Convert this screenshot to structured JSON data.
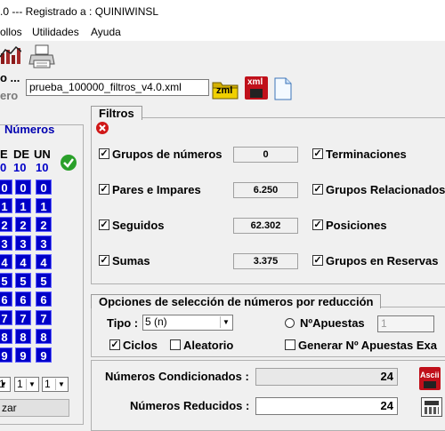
{
  "window": {
    "title": ".0 --- Registrado a : QUINIWINSL"
  },
  "menu": {
    "items": [
      "ollos",
      "Utilidades",
      "Ayuda"
    ]
  },
  "toolbar": {
    "label_top": "o ...",
    "label_bottom": "ero"
  },
  "file": {
    "name": "prueba_100000_filtros_v4.0.xml"
  },
  "icons": {
    "xml_folder": "zml",
    "xml_save": "xml"
  },
  "left_panel": {
    "title": "Números",
    "header": [
      "E",
      "DE",
      "UN"
    ],
    "header_values": [
      "0",
      "10",
      "10",
      "10"
    ],
    "rows": [
      [
        "0",
        "0",
        "0"
      ],
      [
        "1",
        "1",
        "1"
      ],
      [
        "2",
        "2",
        "2"
      ],
      [
        "3",
        "3",
        "3"
      ],
      [
        "4",
        "4",
        "4"
      ],
      [
        "5",
        "5",
        "5"
      ],
      [
        "6",
        "6",
        "6"
      ],
      [
        "7",
        "7",
        "7"
      ],
      [
        "8",
        "8",
        "8"
      ],
      [
        "9",
        "9",
        "9"
      ]
    ],
    "selects": [
      "1",
      "1",
      "1"
    ],
    "button": "zar"
  },
  "filtros": {
    "title": "Filtros",
    "items": [
      {
        "label": "Grupos de números",
        "value": "0",
        "checked": true
      },
      {
        "label": "Pares e Impares",
        "value": "6.250",
        "checked": true
      },
      {
        "label": "Seguidos",
        "value": "62.302",
        "checked": true
      },
      {
        "label": "Sumas",
        "value": "3.375",
        "checked": true
      }
    ],
    "right_items": [
      {
        "label": "Terminaciones",
        "checked": true
      },
      {
        "label": "Grupos Relacionados",
        "checked": true
      },
      {
        "label": "Posiciones",
        "checked": true
      },
      {
        "label": "Grupos en Reservas",
        "checked": true
      }
    ]
  },
  "opciones": {
    "title": "Opciones de selección de números por reducción",
    "tipo_label": "Tipo :",
    "tipo_value": "5 (n)",
    "napuestas_label": "NºApuestas",
    "napuestas_value": "1",
    "ciclos_label": "Ciclos",
    "ciclos_checked": true,
    "aleatorio_label": "Aleatorio",
    "aleatorio_checked": false,
    "generar_label": "Generar Nº Apuestas Exa",
    "generar_checked": false
  },
  "results": {
    "condicionados_label": "Números Condicionados :",
    "condicionados_value": "24",
    "reducidos_label": "Números Reducidos :",
    "reducidos_value": "24",
    "ascii_label": "Ascii"
  }
}
